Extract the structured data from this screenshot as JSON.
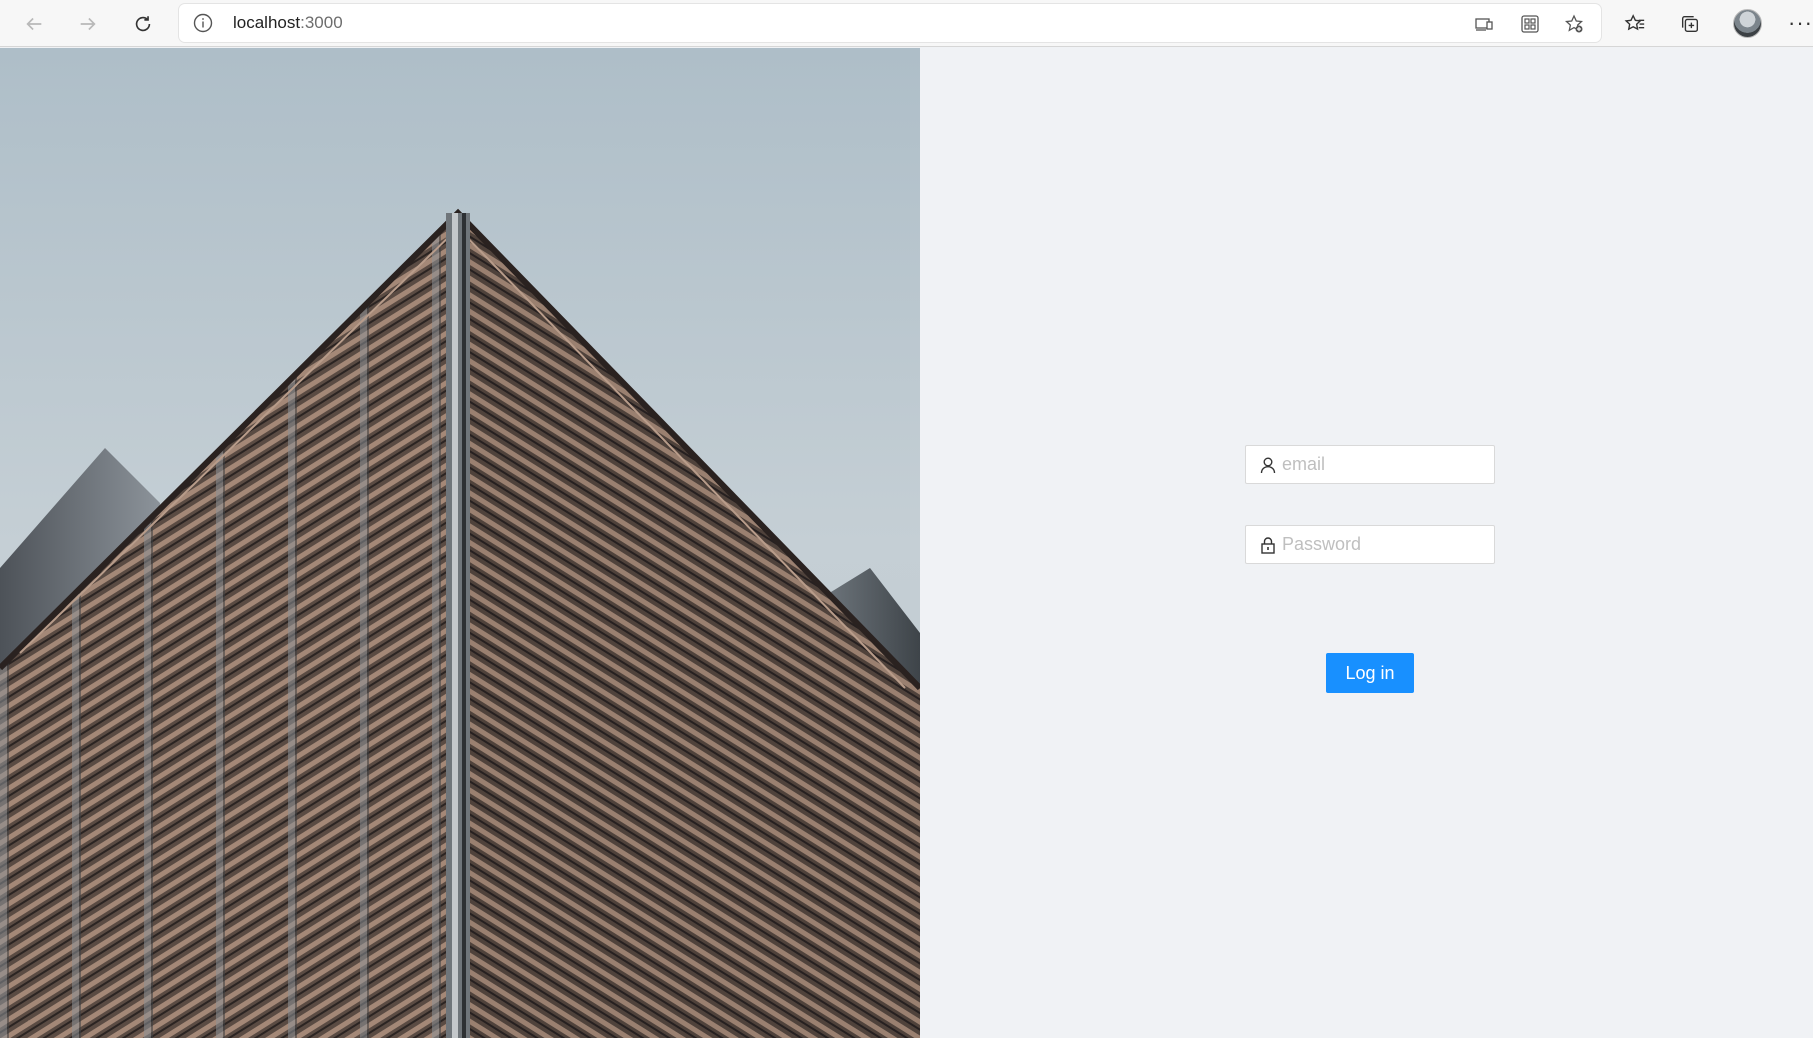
{
  "browser": {
    "url_host": "localhost",
    "url_port": ":3000",
    "icons": {
      "back": "back-arrow-icon",
      "forward": "forward-arrow-icon",
      "refresh": "refresh-icon",
      "site_info": "info-icon",
      "read_aloud": "immersive-reader-icon",
      "apps": "app-available-icon",
      "add_favorite": "add-favorite-icon",
      "favorites": "favorites-icon",
      "collections": "collections-icon",
      "profile": "profile-avatar",
      "more": "more-icon"
    },
    "more_label": "···"
  },
  "hero": {
    "image": "building-facade-photo"
  },
  "login": {
    "email_placeholder": "email",
    "password_placeholder": "Password",
    "submit_label": "Log in",
    "button_color": "#1890ff"
  }
}
